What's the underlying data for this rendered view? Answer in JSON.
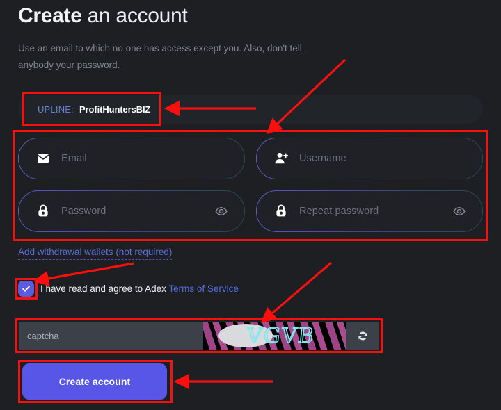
{
  "theme": {
    "background": "#1d1f23",
    "accent": "#5756e6",
    "link": "#4f6fe0",
    "annotation": "#fa0f0f",
    "field_bg": "#1f2126",
    "captcha_bg": "#3c4048"
  },
  "header": {
    "title_bold": "Create",
    "title_light": " an account",
    "subtitle": "Use an email to which no one has access except you. Also, don't tell anybody your password."
  },
  "upline": {
    "label": "UPLINE:",
    "value": "ProfitHuntersBIZ"
  },
  "fields": [
    {
      "name": "email",
      "placeholder": "Email",
      "icon": "envelope-icon",
      "has_eye": false
    },
    {
      "name": "username",
      "placeholder": "Username",
      "icon": "person-add-icon",
      "has_eye": false
    },
    {
      "name": "password",
      "placeholder": "Password",
      "icon": "lock-icon",
      "has_eye": true
    },
    {
      "name": "repeat_password",
      "placeholder": "Repeat password",
      "icon": "lock-icon",
      "has_eye": true
    }
  ],
  "wallets": {
    "link_text": "Add withdrawal wallets (not required)"
  },
  "terms": {
    "checked": true,
    "text": "I have read and agree to Adex",
    "link_text": "Terms of Service"
  },
  "captcha": {
    "placeholder": "captcha",
    "value": "",
    "image_text": "VGVB",
    "refresh_icon": "refresh-icon"
  },
  "submit": {
    "label": "Create account"
  }
}
